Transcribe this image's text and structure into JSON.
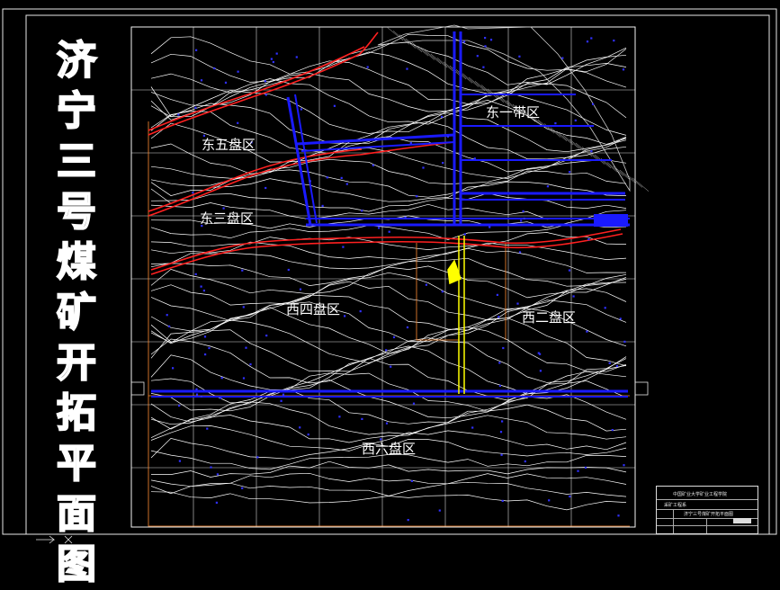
{
  "drawing": {
    "title_chars": [
      "济",
      "宁",
      "三",
      "号",
      "煤",
      "矿",
      "开",
      "拓",
      "平",
      "面",
      "图"
    ],
    "zones": [
      {
        "id": "dong-yi-dai",
        "label": "东一带区"
      },
      {
        "id": "dong-wu-pan",
        "label": "东五盘区"
      },
      {
        "id": "dong-san-pan",
        "label": "东三盘区"
      },
      {
        "id": "xi-si-pan",
        "label": "西四盘区"
      },
      {
        "id": "xi-er-pan",
        "label": "西二盘区"
      },
      {
        "id": "xi-liu-pan",
        "label": "西六盘区"
      }
    ],
    "titleblock": {
      "school": "中国矿业大学矿业工程学院",
      "dept": "采矿工程系",
      "drawing_name": "济宁三号煤矿开拓平面图"
    }
  },
  "colors": {
    "background": "#000000",
    "frame": "#e8e8e8",
    "grid": "#ffffff",
    "contour": "#ffffff",
    "roadway": "#1a1aff",
    "fault": "#ff2020",
    "shaft": "#ffff00",
    "boundary": "#ff8c32"
  }
}
